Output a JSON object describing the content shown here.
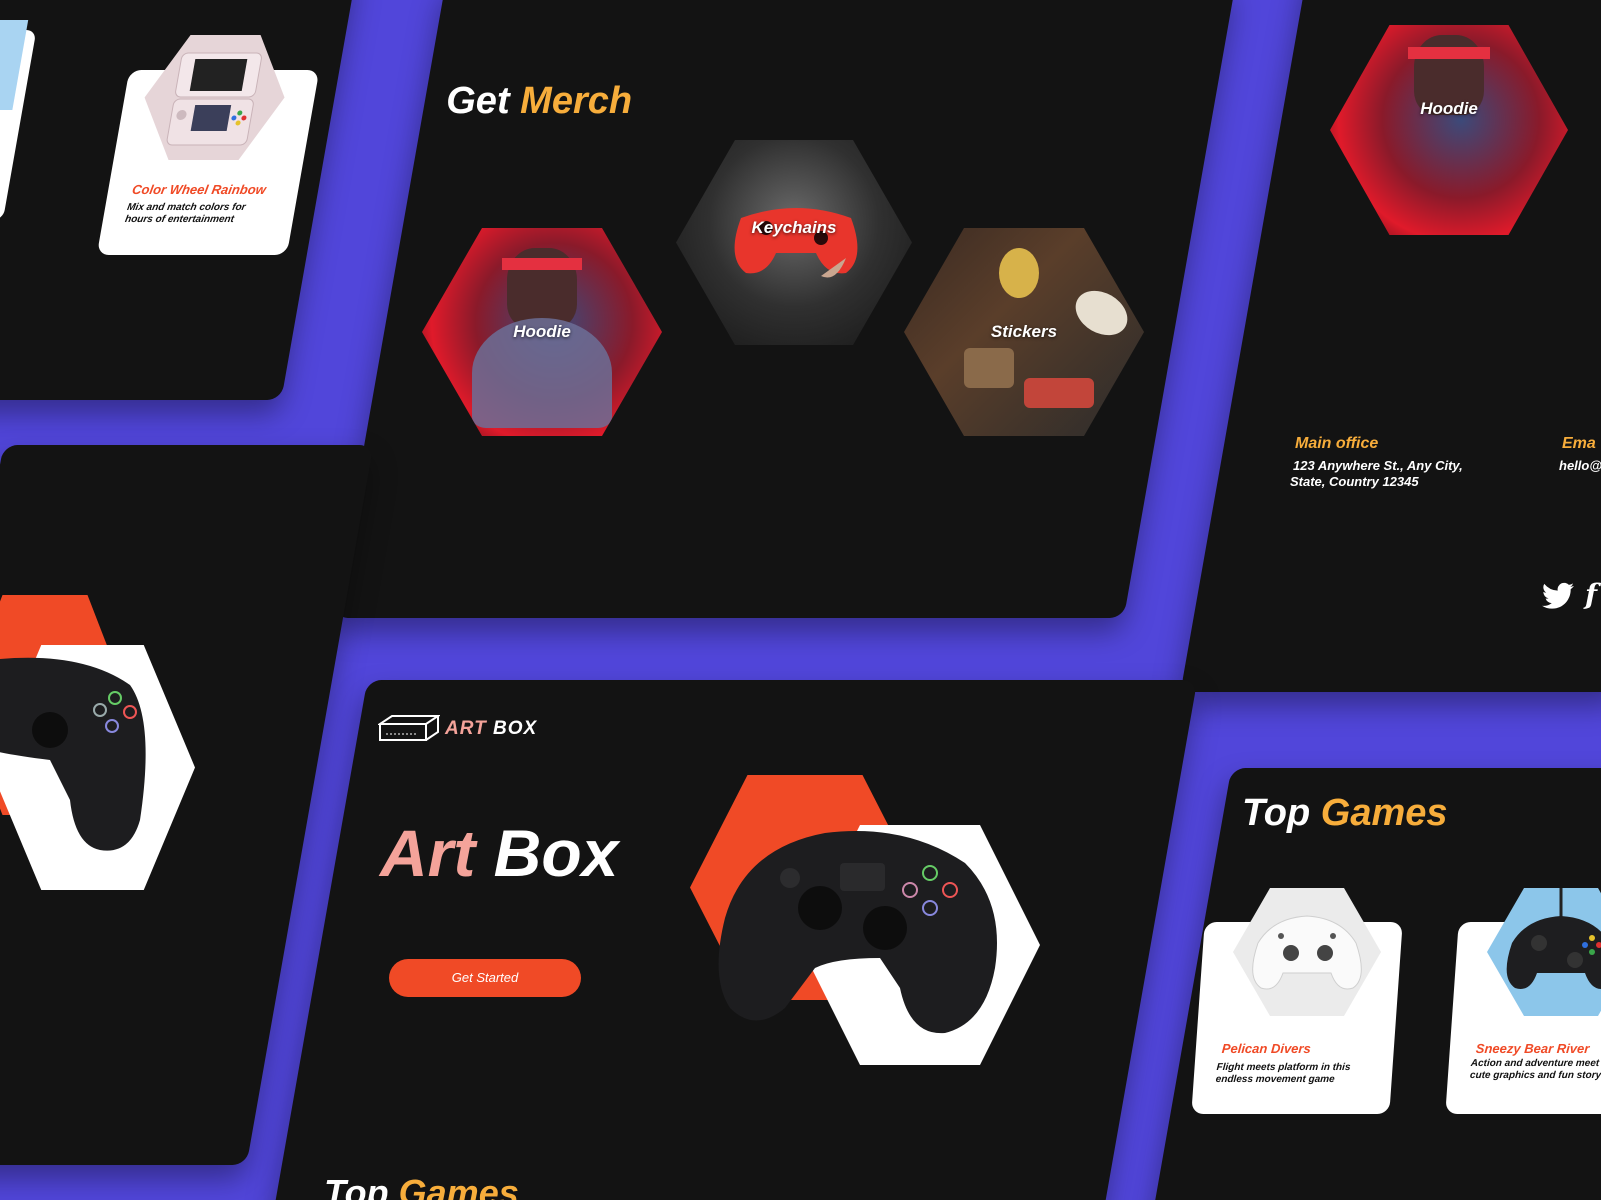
{
  "colors": {
    "background": "#5146da",
    "panel": "#131313",
    "accent_orange": "#f7ad3b",
    "accent_red": "#f04a26",
    "accent_salmon": "#f4a39a"
  },
  "console_card": {
    "title": "Color Wheel Rainbow",
    "description": "Mix and match colors for hours of entertainment"
  },
  "merch": {
    "title_word1": "Get",
    "title_word2": "Merch",
    "items": [
      {
        "label": "Hoodie",
        "icon": "hoodie-photo"
      },
      {
        "label": "Keychains",
        "icon": "red-controller-photo"
      },
      {
        "label": "Stickers",
        "icon": "laptop-stickers-photo"
      }
    ]
  },
  "contact": {
    "hoodie_label": "Hoodie",
    "office_title": "Main office",
    "office_address_line1": "123 Anywhere St., Any City,",
    "office_address_line2": "State, Country 12345",
    "email_title": "Ema",
    "email_value": "hello@",
    "social": [
      {
        "icon": "twitter-icon"
      },
      {
        "icon": "facebook-icon"
      }
    ]
  },
  "hero": {
    "logo_word1": "ART",
    "logo_word2": "BOX",
    "title_word1": "Art",
    "title_word2": "Box",
    "cta": "Get Started"
  },
  "top_games": {
    "title_word1": "Top",
    "title_word2": "Games",
    "games": [
      {
        "title": "Pelican Divers",
        "description": "Flight meets platform in this endless movement game"
      },
      {
        "title": "Sneezy Bear River",
        "description": "Action and adventure meet cute graphics and fun story"
      }
    ]
  },
  "bottom_heading": {
    "title_word1": "Top",
    "title_word2": "Games"
  }
}
